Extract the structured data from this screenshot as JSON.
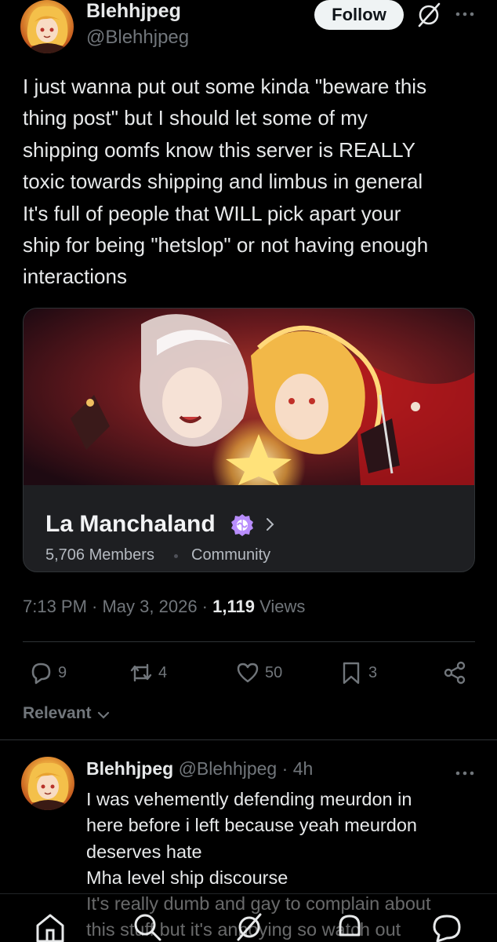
{
  "post": {
    "author_name": "Blehhjpeg",
    "author_handle": "@Blehhjpeg",
    "follow_label": "Follow",
    "text": "I just wanna put out some kinda \"beware this\nthing post\" but I should let some of my\nshipping oomfs know this server is REALLY\ntoxic towards shipping and limbus in general\nIt's full of people that WILL pick apart your\nship for being \"hetslop\" or not having enough\ninteractions",
    "time": "7:13 PM · May 3, 2026 · ",
    "views_count": "1,119",
    "views_label": " Views"
  },
  "card": {
    "title": "La Manchaland",
    "members": "5,706 Members",
    "community": "Community"
  },
  "actions": {
    "replies": "9",
    "reposts": "4",
    "likes": "50",
    "bookmarks": "3"
  },
  "sort_label": "Relevant",
  "reply": {
    "author_name": "Blehhjpeg",
    "author_handle": "@Blehhjpeg",
    "separator": " · ",
    "time": "4h",
    "text": "I was vehemently defending meurdon in\nhere before i left because yeah meurdon\ndeserves hate\nMha level ship discourse\nIt's really dumb and gay to complain about\nthis stuff but it's annoying so watch out"
  },
  "colors": {
    "background": "#000000",
    "text_primary": "#e7e9ea",
    "text_secondary": "#71767b",
    "card_bg": "#1e1f22",
    "verified": "#b88dfc"
  },
  "icons": [
    "grok-icon",
    "more-icon",
    "verified-icon",
    "chevron-right-icon",
    "reply-icon",
    "repost-icon",
    "like-icon",
    "bookmark-icon",
    "share-icon",
    "chevron-down-icon",
    "home-icon",
    "search-icon",
    "grok-icon",
    "notifications-icon",
    "messages-icon"
  ]
}
